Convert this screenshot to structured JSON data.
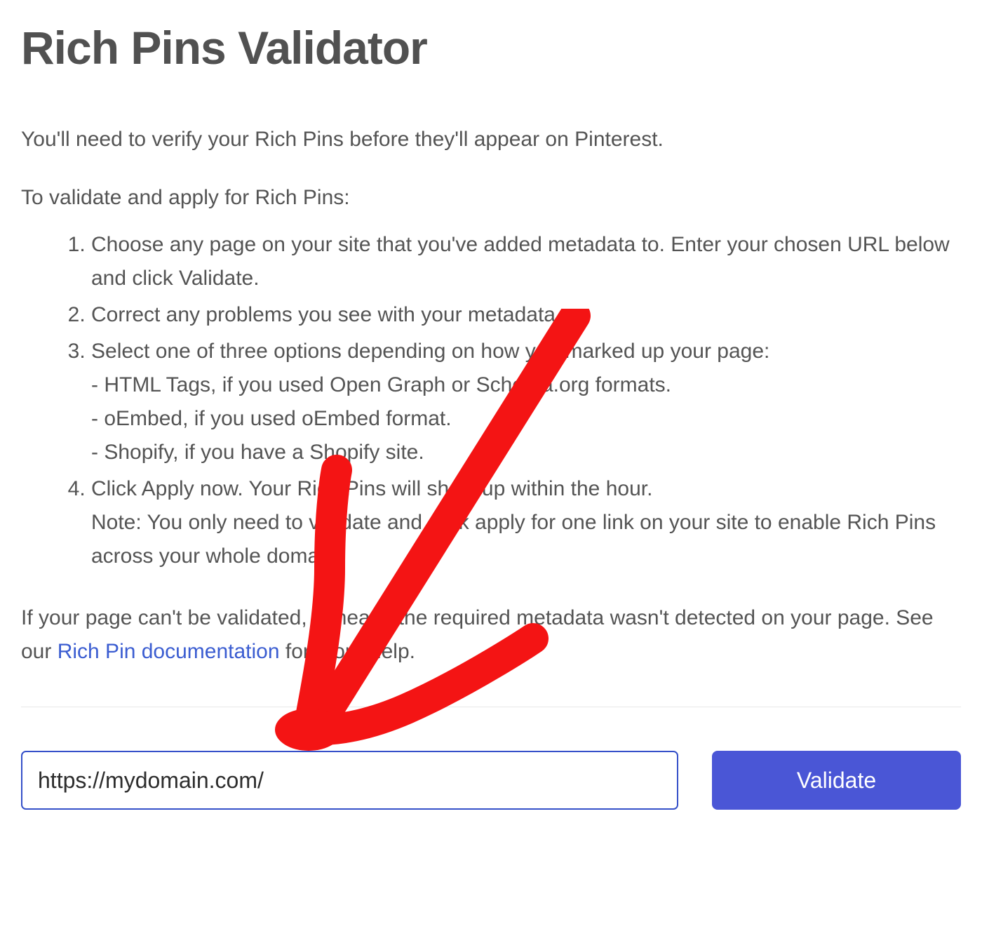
{
  "page": {
    "title": "Rich Pins Validator"
  },
  "intro": "You'll need to verify your Rich Pins before they'll appear on Pinterest.",
  "subheading": "To validate and apply for Rich Pins:",
  "steps": {
    "s1": "Choose any page on your site that you've added metadata to. Enter your chosen URL below and click Validate.",
    "s2": "Correct any problems you see with your metadata.",
    "s3_main": "Select one of three options depending on how you marked up your page:",
    "s3_opt1": "- HTML Tags, if you used Open Graph or Schema.org formats.",
    "s3_opt2": "- oEmbed, if you used oEmbed format.",
    "s3_opt3": "- Shopify, if you have a Shopify site.",
    "s4_main": "Click Apply now. Your Rich Pins will show up within the hour.",
    "s4_note": "Note: You only need to validate and click apply for one link on your site to enable Rich Pins across your whole domain."
  },
  "closing": {
    "prefix": "If your page can't be validated, it means the required metadata wasn't detected on your page. See our ",
    "link_text": "Rich Pin documentation",
    "suffix": " for more help."
  },
  "form": {
    "url_value": "https://mydomain.com/",
    "validate_label": "Validate"
  },
  "annotation": {
    "arrow_color": "#f41414"
  }
}
